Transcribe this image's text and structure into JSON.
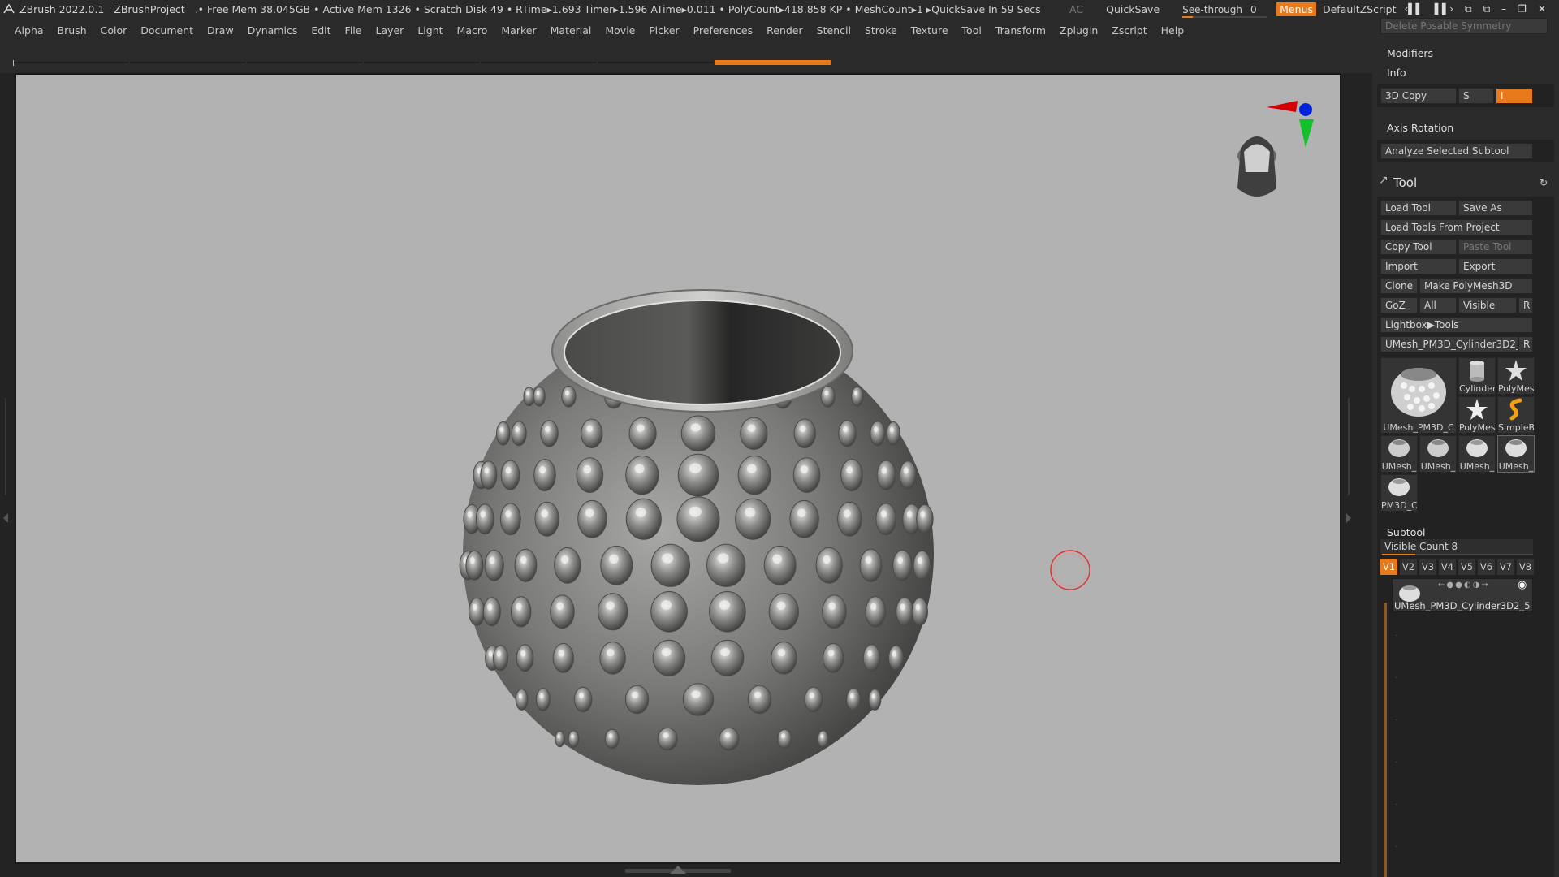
{
  "titlebar": {
    "app": "ZBrush 2022.0.1",
    "project": "ZBrushProject",
    "stats": ".• Free Mem 38.045GB • Active Mem 1326 • Scratch Disk 49 •  RTime▸1.693 Timer▸1.596 ATime▸0.011 • PolyCount▸418.858 KP  • MeshCount▸1  ▸QuickSave In 59 Secs",
    "ac": "AC",
    "quicksave": "QuickSave",
    "see_through_label": "See-through",
    "see_through_value": "0",
    "see_through_level": 0.0,
    "menus": "Menus",
    "default_zscript": "DefaultZScript"
  },
  "menubar": [
    "Alpha",
    "Brush",
    "Color",
    "Document",
    "Draw",
    "Dynamics",
    "Edit",
    "File",
    "Layer",
    "Light",
    "Macro",
    "Marker",
    "Material",
    "Movie",
    "Picker",
    "Preferences",
    "Render",
    "Stencil",
    "Stroke",
    "Texture",
    "Tool",
    "Transform",
    "Zplugin",
    "Zscript",
    "Help"
  ],
  "panel": {
    "delete_posable": "Delete Posable Symmetry",
    "modifiers": "Modifiers",
    "info": "Info",
    "copy3d": "3D Copy",
    "s": "S",
    "axis_rotation": "Axis Rotation",
    "analyze": "Analyze Selected Subtool",
    "tool_title": "Tool",
    "load_tool": "Load Tool",
    "save_as": "Save As",
    "load_from_project": "Load Tools From Project",
    "copy_tool": "Copy Tool",
    "paste_tool": "Paste Tool",
    "import": "Import",
    "export": "Export",
    "clone": "Clone",
    "make_polymesh": "Make PolyMesh3D",
    "goz": "GoZ",
    "all": "All",
    "visible": "Visible",
    "r": "R",
    "lightbox_tools": "Lightbox▶Tools",
    "current_tool": "UMesh_PM3D_Cylinder3D2_5",
    "thumbs": {
      "main": "UMesh_PM3D_C",
      "cylinder": "Cylinder",
      "polymesh1": "PolyMes",
      "polymesh2": "PolyMes",
      "simpleb": "SimpleB",
      "u1": "UMesh_",
      "u2": "UMesh_",
      "u3": "UMesh_",
      "u4": "UMesh_",
      "pm3d": "PM3D_C"
    },
    "subtool_title": "Subtool",
    "visible_count": "Visible Count 8",
    "vtabs": [
      "V1",
      "V2",
      "V3",
      "V4",
      "V5",
      "V6",
      "V7",
      "V8"
    ],
    "subtool_name": "UMesh_PM3D_Cylinder3D2_5"
  },
  "colors": {
    "accent": "#e87a1c",
    "viewport_bg": "#b2b2b2",
    "ui_bg": "#2a2a2a"
  }
}
